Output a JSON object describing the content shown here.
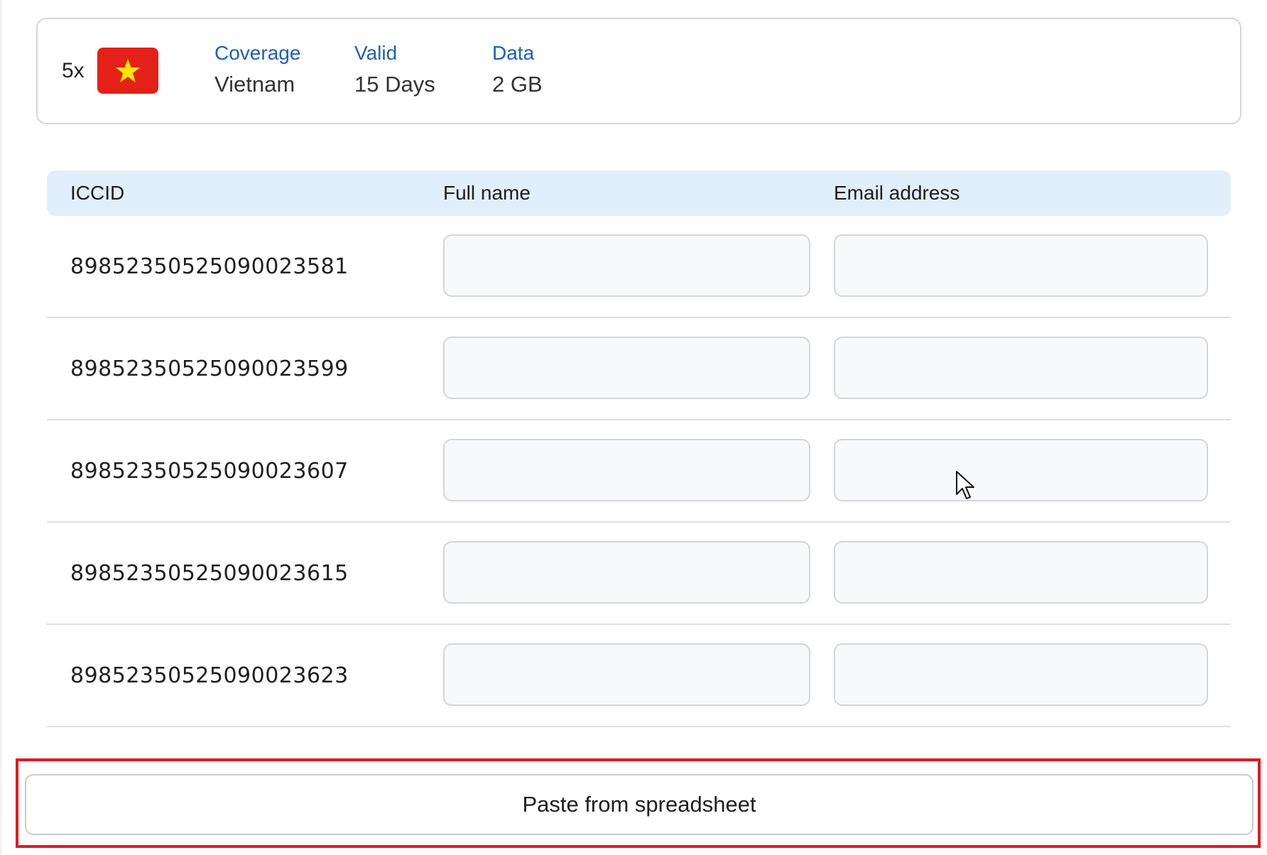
{
  "plan": {
    "quantity": "5x",
    "flag_icon": "vietnam-flag",
    "flag_color": "#e32119",
    "star_color": "#ffe600",
    "coverage_label": "Coverage",
    "coverage_value": "Vietnam",
    "valid_label": "Valid",
    "valid_value": "15 Days",
    "data_label": "Data",
    "data_value": "2 GB"
  },
  "table": {
    "headers": {
      "iccid": "ICCID",
      "full_name": "Full name",
      "email": "Email address"
    },
    "rows": [
      {
        "iccid": "89852350525090023581",
        "full_name": "",
        "email": ""
      },
      {
        "iccid": "89852350525090023599",
        "full_name": "",
        "email": ""
      },
      {
        "iccid": "89852350525090023607",
        "full_name": "",
        "email": ""
      },
      {
        "iccid": "89852350525090023615",
        "full_name": "",
        "email": ""
      },
      {
        "iccid": "89852350525090023623",
        "full_name": "",
        "email": ""
      }
    ]
  },
  "actions": {
    "paste_label": "Paste from spreadsheet"
  },
  "colors": {
    "accent": "#1d5fb8",
    "header_bg": "#e1eefb",
    "highlight": "#e3191f"
  }
}
